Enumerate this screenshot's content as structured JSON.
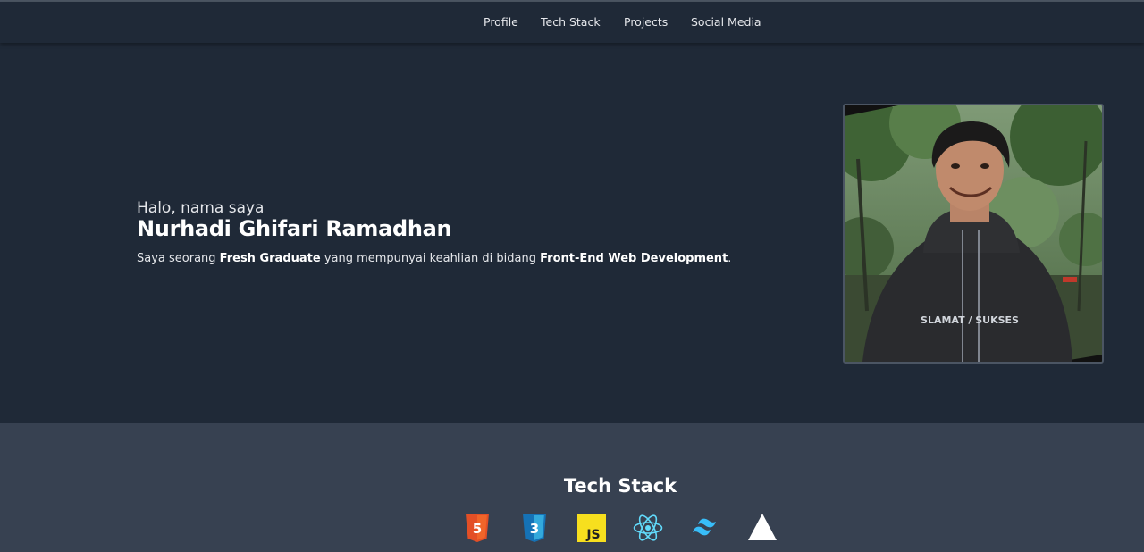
{
  "nav": {
    "items": [
      {
        "label": "Profile"
      },
      {
        "label": "Tech Stack"
      },
      {
        "label": "Projects"
      },
      {
        "label": "Social Media"
      }
    ]
  },
  "hero": {
    "greeting": "Halo, nama saya",
    "name": "Nurhadi Ghifari Ramadhan",
    "description": {
      "prefix": "Saya seorang ",
      "highlight1": "Fresh Graduate",
      "middle": " yang mempunyai keahlian di bidang ",
      "highlight2": "Front-End Web Development",
      "suffix": "."
    },
    "photo": {
      "shirt_text": "SLAMAT / SUKSES"
    }
  },
  "tech_stack": {
    "title": "Tech Stack",
    "icons": [
      {
        "name": "html5-icon",
        "color": "#e34f26",
        "label": "5"
      },
      {
        "name": "css3-icon",
        "color": "#1572b6",
        "label": "3"
      },
      {
        "name": "javascript-icon",
        "color": "#f7df1e",
        "label": "JS"
      },
      {
        "name": "react-icon",
        "color": "#61dafb"
      },
      {
        "name": "tailwind-icon",
        "color": "#38bdf8"
      },
      {
        "name": "vercel-icon",
        "color": "#ffffff"
      }
    ]
  },
  "colors": {
    "header_bg": "#1f2937",
    "hero_bg": "#1f2937",
    "tech_bg": "#374151",
    "text": "#ffffff"
  }
}
